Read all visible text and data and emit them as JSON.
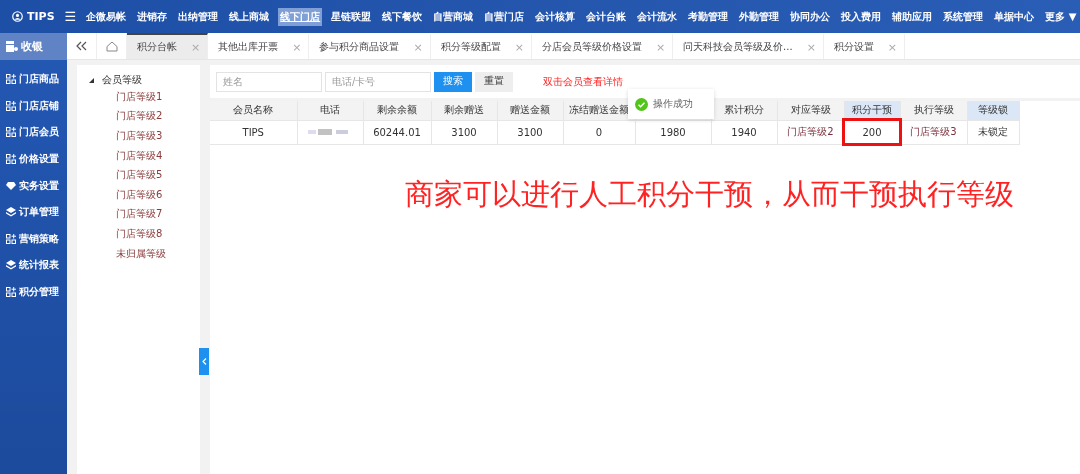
{
  "top_bar": {
    "brand": "TIPS",
    "menu_icon": "☰",
    "items": [
      {
        "label": "企微易帐",
        "selected": false
      },
      {
        "label": "进销存",
        "selected": false
      },
      {
        "label": "出纳管理",
        "selected": false
      },
      {
        "label": "线上商城",
        "selected": false
      },
      {
        "label": "线下门店",
        "selected": true
      },
      {
        "label": "星链联盟",
        "selected": false
      },
      {
        "label": "线下餐饮",
        "selected": false
      },
      {
        "label": "自营商城",
        "selected": false
      },
      {
        "label": "自营门店",
        "selected": false
      },
      {
        "label": "会计核算",
        "selected": false
      },
      {
        "label": "会计台账",
        "selected": false
      },
      {
        "label": "会计流水",
        "selected": false
      },
      {
        "label": "考勤管理",
        "selected": false
      },
      {
        "label": "外勤管理",
        "selected": false
      },
      {
        "label": "协同办公",
        "selected": false
      },
      {
        "label": "投入费用",
        "selected": false
      },
      {
        "label": "辅助应用",
        "selected": false
      },
      {
        "label": "系统管理",
        "selected": false
      },
      {
        "label": "单据中心",
        "selected": false
      }
    ],
    "more": "更多 ▼"
  },
  "sidebar": {
    "header": "收银",
    "items": [
      {
        "label": "门店商品",
        "kind": "grid"
      },
      {
        "label": "门店店铺",
        "kind": "grid"
      },
      {
        "label": "门店会员",
        "kind": "grid"
      },
      {
        "label": "价格设置",
        "kind": "grid"
      },
      {
        "label": "实务设置",
        "kind": "diamond"
      },
      {
        "label": "订单管理",
        "kind": "layers"
      },
      {
        "label": "营销策略",
        "kind": "grid"
      },
      {
        "label": "统计报表",
        "kind": "layers"
      },
      {
        "label": "积分管理",
        "kind": "grid"
      }
    ]
  },
  "tabs": [
    {
      "label": "积分台帐",
      "selected": true
    },
    {
      "label": "其他出库开票",
      "selected": false
    },
    {
      "label": "参与积分商品设置",
      "selected": false
    },
    {
      "label": "积分等级配置",
      "selected": false
    },
    {
      "label": "分店会员等级价格设置",
      "selected": false
    },
    {
      "label": "问天科技会员等级及价...",
      "selected": false
    },
    {
      "label": "积分设置",
      "selected": false
    }
  ],
  "tab_close": "×",
  "tree": {
    "label": "会员等级",
    "expanded": true,
    "children": [
      {
        "label": "门店等级1"
      },
      {
        "label": "门店等级2"
      },
      {
        "label": "门店等级3"
      },
      {
        "label": "门店等级4"
      },
      {
        "label": "门店等级5"
      },
      {
        "label": "门店等级6"
      },
      {
        "label": "门店等级7"
      },
      {
        "label": "门店等级8"
      },
      {
        "label": "未归属等级"
      }
    ]
  },
  "search": {
    "name_placeholder": "姓名",
    "phone_placeholder": "电话/卡号",
    "search_button": "搜索",
    "reset_button": "重置",
    "hint": "双击会员查看详情"
  },
  "table": {
    "columns": [
      {
        "header": "会员名称",
        "selected": false
      },
      {
        "header": "电话",
        "selected": false
      },
      {
        "header": "剩余余额",
        "selected": false
      },
      {
        "header": "剩余赠送",
        "selected": false
      },
      {
        "header": "赠送金额",
        "selected": false
      },
      {
        "header": "冻结赠送金额",
        "selected": false
      },
      {
        "selected": false
      },
      {
        "header": "累计积分",
        "selected": false
      },
      {
        "header": "对应等级",
        "selected": false
      },
      {
        "header": "积分干预",
        "selected": true
      },
      {
        "header": "执行等级",
        "selected": false
      },
      {
        "header": "等级锁",
        "selected": true
      }
    ],
    "rows": [
      {
        "cells": [
          {
            "text": "TIPS"
          },
          {
            "kind": "blurred"
          },
          {
            "text": "60244.01"
          },
          {
            "text": "3100"
          },
          {
            "text": "3100"
          },
          {
            "text": "0"
          },
          {
            "text": "1980"
          },
          {
            "text": "1940"
          },
          {
            "text": "门店等级2",
            "kind": "level"
          },
          {
            "text": "200",
            "highlighted": true
          },
          {
            "text": "门店等级3",
            "kind": "level"
          },
          {
            "text": "未锁定"
          }
        ]
      }
    ]
  },
  "toast": {
    "message": "操作成功"
  },
  "annotation": "商家可以进行人工积分干预，从而干预执行等级"
}
